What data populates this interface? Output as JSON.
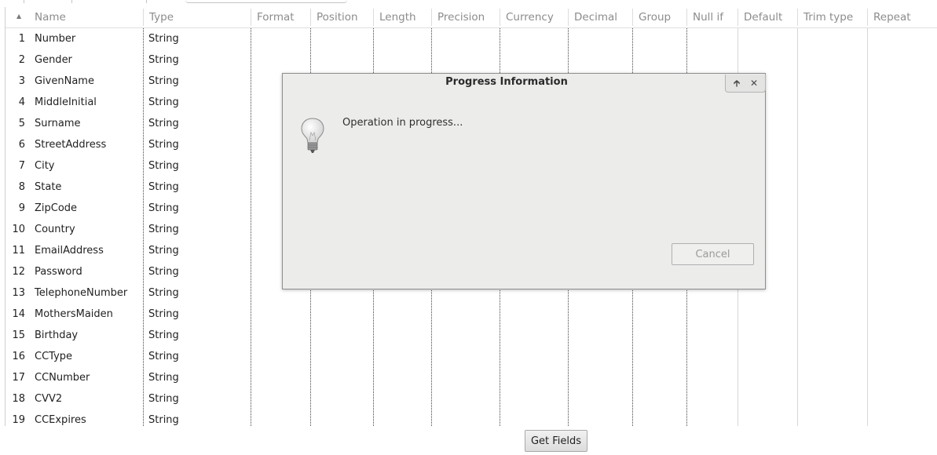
{
  "grid": {
    "columns": [
      "Name",
      "Type",
      "Format",
      "Position",
      "Length",
      "Precision",
      "Currency",
      "Decimal",
      "Group",
      "Null if",
      "Default",
      "Trim type",
      "Repeat"
    ],
    "rows": [
      {
        "num": "1",
        "name": "Number",
        "type": "String"
      },
      {
        "num": "2",
        "name": "Gender",
        "type": "String"
      },
      {
        "num": "3",
        "name": "GivenName",
        "type": "String"
      },
      {
        "num": "4",
        "name": "MiddleInitial",
        "type": "String"
      },
      {
        "num": "5",
        "name": "Surname",
        "type": "String"
      },
      {
        "num": "6",
        "name": "StreetAddress",
        "type": "String"
      },
      {
        "num": "7",
        "name": "City",
        "type": "String"
      },
      {
        "num": "8",
        "name": "State",
        "type": "String"
      },
      {
        "num": "9",
        "name": "ZipCode",
        "type": "String"
      },
      {
        "num": "10",
        "name": "Country",
        "type": "String"
      },
      {
        "num": "11",
        "name": "EmailAddress",
        "type": "String"
      },
      {
        "num": "12",
        "name": "Password",
        "type": "String"
      },
      {
        "num": "13",
        "name": "TelephoneNumber",
        "type": "String"
      },
      {
        "num": "14",
        "name": "MothersMaiden",
        "type": "String"
      },
      {
        "num": "15",
        "name": "Birthday",
        "type": "String"
      },
      {
        "num": "16",
        "name": "CCType",
        "type": "String"
      },
      {
        "num": "17",
        "name": "CCNumber",
        "type": "String"
      },
      {
        "num": "18",
        "name": "CVV2",
        "type": "String"
      },
      {
        "num": "19",
        "name": "CCExpires",
        "type": "String"
      }
    ]
  },
  "buttons": {
    "get_fields": "Get Fields"
  },
  "dialog": {
    "title": "Progress Information",
    "message": "Operation in progress...",
    "cancel": "Cancel",
    "icons": {
      "maximize": "arrow-up-icon",
      "close": "close-icon",
      "main": "lightbulb-icon"
    }
  }
}
